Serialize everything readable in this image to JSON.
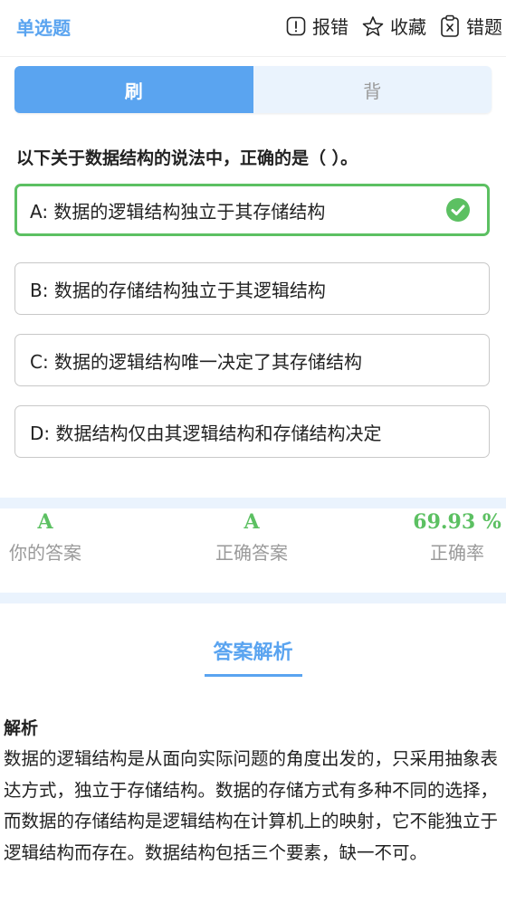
{
  "header": {
    "question_type": "单选题",
    "actions": [
      {
        "label": "报错",
        "icon": "report-icon"
      },
      {
        "label": "收藏",
        "icon": "star-icon"
      },
      {
        "label": "错题",
        "icon": "wrong-book-icon"
      }
    ]
  },
  "mode_toggle": {
    "active_label": "刷",
    "inactive_label": "背",
    "selected": "刷"
  },
  "question": {
    "text": "以下关于数据结构的说法中，正确的是（ ）。",
    "options": [
      {
        "text": "A: 数据的逻辑结构独立于其存储结构",
        "correct": true
      },
      {
        "text": "B: 数据的存储结构独立于其逻辑结构",
        "correct": false
      },
      {
        "text": "C: 数据的逻辑结构唯一决定了其存储结构",
        "correct": false
      },
      {
        "text": "D: 数据结构仅由其逻辑结构和存储结构决定",
        "correct": false
      }
    ]
  },
  "stats": {
    "your_answer": {
      "value": "A",
      "label": "你的答案"
    },
    "correct_answer": {
      "value": "A",
      "label": "正确答案"
    },
    "accuracy": {
      "value": "69.93 %",
      "label": "正确率"
    }
  },
  "analysis": {
    "title": "答案解析",
    "label": "解析",
    "body": "数据的逻辑结构是从面向实际问题的角度出发的，只采用抽象表达方式，独立于存储结构。数据的存储方式有多种不同的选择，而数据的存储结构是逻辑结构在计算机上的映射，它不能独立于逻辑结构而存在。数据结构包括三个要素，缺一不可。"
  },
  "colors": {
    "accent": "#5aa4f0",
    "correct": "#5cc062",
    "band": "#eaf3fd",
    "muted": "#9a9a9a"
  }
}
